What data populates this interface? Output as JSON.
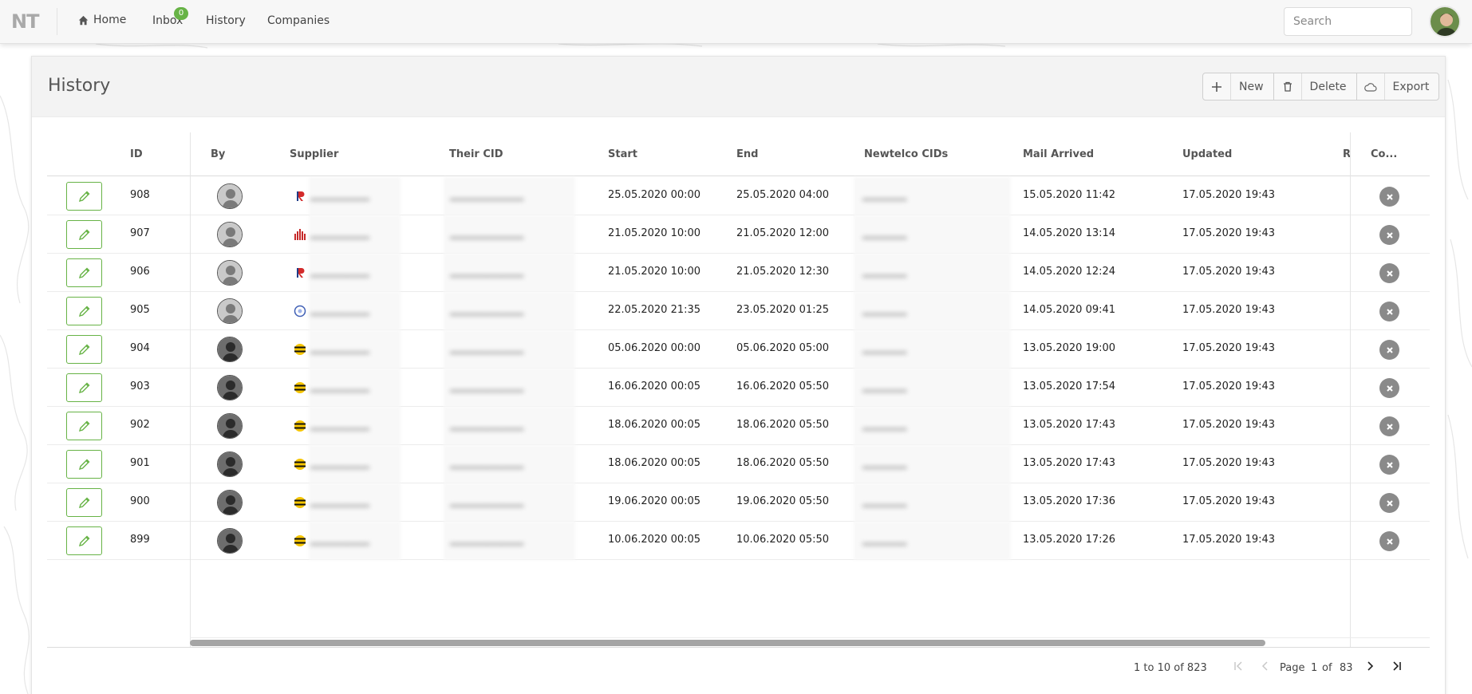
{
  "nav": {
    "logo": "NT",
    "home": "Home",
    "inbox": "Inbox",
    "inbox_count": "0",
    "history": "History",
    "companies": "Companies",
    "search_placeholder": "Search"
  },
  "page": {
    "title": "History",
    "new_label": "New",
    "delete_label": "Delete",
    "export_label": "Export"
  },
  "columns": {
    "id": "ID",
    "by": "By",
    "supplier": "Supplier",
    "their_cid": "Their CID",
    "start": "Start",
    "end": "End",
    "newtelco_cids": "Newtelco CIDs",
    "mail_arrived": "Mail Arrived",
    "updated": "Updated",
    "r": "R",
    "co": "Co..."
  },
  "rows": [
    {
      "id": "908",
      "start": "25.05.2020 00:00",
      "end": "25.05.2020 04:00",
      "mail": "15.05.2020 11:42",
      "updated": "17.05.2020 19:43",
      "supplier_icon": "r-logo"
    },
    {
      "id": "907",
      "start": "21.05.2020 10:00",
      "end": "21.05.2020 12:00",
      "mail": "14.05.2020 13:14",
      "updated": "17.05.2020 19:43",
      "supplier_icon": "bars-logo"
    },
    {
      "id": "906",
      "start": "21.05.2020 10:00",
      "end": "21.05.2020 12:30",
      "mail": "14.05.2020 12:24",
      "updated": "17.05.2020 19:43",
      "supplier_icon": "r-logo"
    },
    {
      "id": "905",
      "start": "22.05.2020 21:35",
      "end": "23.05.2020 01:25",
      "mail": "14.05.2020 09:41",
      "updated": "17.05.2020 19:43",
      "supplier_icon": "globe-logo"
    },
    {
      "id": "904",
      "start": "05.06.2020 00:00",
      "end": "05.06.2020 05:00",
      "mail": "13.05.2020 19:00",
      "updated": "17.05.2020 19:43",
      "supplier_icon": "striped-ball-logo"
    },
    {
      "id": "903",
      "start": "16.06.2020 00:05",
      "end": "16.06.2020 05:50",
      "mail": "13.05.2020 17:54",
      "updated": "17.05.2020 19:43",
      "supplier_icon": "striped-ball-logo"
    },
    {
      "id": "902",
      "start": "18.06.2020 00:05",
      "end": "18.06.2020 05:50",
      "mail": "13.05.2020 17:43",
      "updated": "17.05.2020 19:43",
      "supplier_icon": "striped-ball-logo"
    },
    {
      "id": "901",
      "start": "18.06.2020 00:05",
      "end": "18.06.2020 05:50",
      "mail": "13.05.2020 17:43",
      "updated": "17.05.2020 19:43",
      "supplier_icon": "striped-ball-logo"
    },
    {
      "id": "900",
      "start": "19.06.2020 00:05",
      "end": "19.06.2020 05:50",
      "mail": "13.05.2020 17:36",
      "updated": "17.05.2020 19:43",
      "supplier_icon": "striped-ball-logo"
    },
    {
      "id": "899",
      "start": "10.06.2020 00:05",
      "end": "10.06.2020 05:50",
      "mail": "13.05.2020 17:26",
      "updated": "17.05.2020 19:43",
      "supplier_icon": "striped-ball-logo"
    }
  ],
  "paging": {
    "summary": "1 to 10 of 823",
    "page_label": "Page",
    "current": "1",
    "of_label": "of",
    "total": "83"
  },
  "colors": {
    "accent_green": "#67b346",
    "close_grey": "#8a8a8a"
  }
}
